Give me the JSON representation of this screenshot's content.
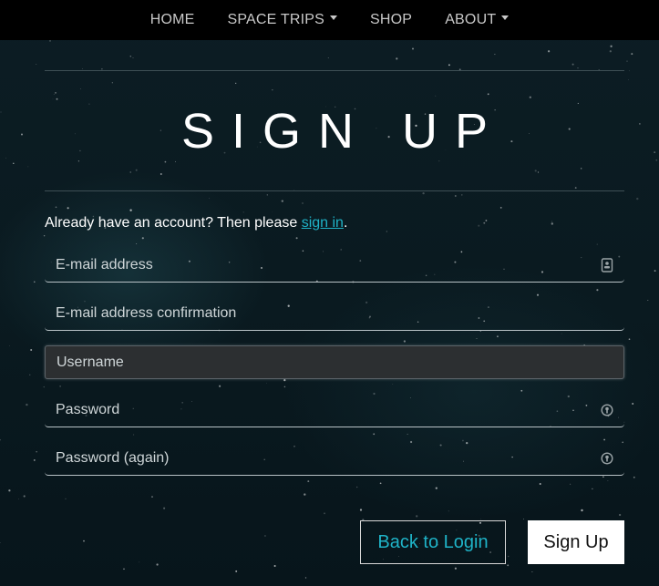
{
  "nav": {
    "items": [
      {
        "label": "HOME",
        "dropdown": false
      },
      {
        "label": "SPACE TRIPS",
        "dropdown": true
      },
      {
        "label": "SHOP",
        "dropdown": false
      },
      {
        "label": "ABOUT",
        "dropdown": true
      }
    ]
  },
  "page": {
    "title": "SIGN UP",
    "signin_prompt": "Already have an account? Then please",
    "signin_link": "sign in",
    "signin_suffix": "."
  },
  "form": {
    "email_placeholder": "E-mail address",
    "email_confirm_placeholder": "E-mail address confirmation",
    "username_placeholder": "Username",
    "password_placeholder": "Password",
    "password_again_placeholder": "Password (again)",
    "active_field": "username",
    "email_icon": "contact-card-icon",
    "password_icon": "key-icon"
  },
  "buttons": {
    "back_label": "Back to Login",
    "signup_label": "Sign Up"
  },
  "colors": {
    "accent": "#1fb3c7",
    "navbar_bg": "#000000",
    "page_bg": "#0a1a20"
  }
}
